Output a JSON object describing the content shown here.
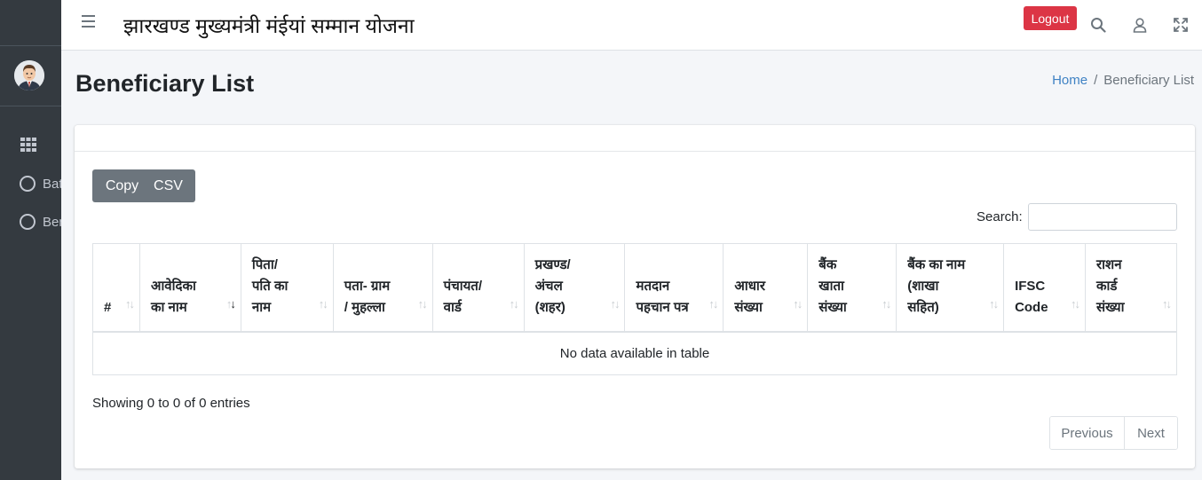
{
  "sidebar": {
    "items": [
      {
        "label": "Batch List"
      },
      {
        "label": "Beneficiary List"
      }
    ]
  },
  "navbar": {
    "title": "झारखण्ड मुख्यमंत्री मंईयां सम्मान योजना",
    "logout_label": "Logout"
  },
  "page": {
    "title": "Beneficiary List",
    "breadcrumb": {
      "home": "Home",
      "current": "Beneficiary List"
    }
  },
  "table_controls": {
    "copy_label": "Copy",
    "csv_label": "CSV",
    "search_label": "Search:",
    "search_value": ""
  },
  "table": {
    "columns": [
      [
        "#"
      ],
      [
        "आवेदिका",
        "का नाम"
      ],
      [
        "पिता/",
        "पति का",
        "नाम"
      ],
      [
        "पता- ग्राम",
        "/ मुहल्ला"
      ],
      [
        "पंचायत/",
        "वार्ड"
      ],
      [
        "प्रखण्ड/",
        "अंचल",
        "(शहर)"
      ],
      [
        "मतदान",
        "पहचान पत्र"
      ],
      [
        "आधार",
        "संख्या"
      ],
      [
        "बैंक",
        "खाता",
        "संख्या"
      ],
      [
        "बैंक का नाम",
        "(शाखा",
        "सहित)"
      ],
      [
        "IFSC",
        "Code"
      ],
      [
        "राशन",
        "कार्ड",
        "संख्या"
      ]
    ],
    "empty_message": "No data available in table"
  },
  "footer": {
    "info": "Showing 0 to 0 of 0 entries",
    "previous_label": "Previous",
    "next_label": "Next"
  },
  "colors": {
    "sidebar_bg": "#343a40",
    "logout_bg": "#dc3545",
    "button_bg": "#6c757d",
    "link": "#3f82c4"
  }
}
